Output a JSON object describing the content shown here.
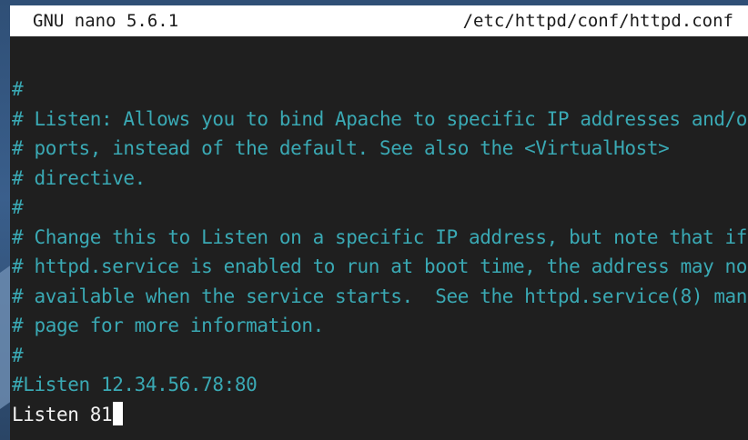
{
  "titlebar": {
    "app_version": "GNU nano 5.6.1",
    "file_path": "/etc/httpd/conf/httpd.conf"
  },
  "lines": [
    "#",
    "# Listen: Allows you to bind Apache to specific IP addresses and/or",
    "# ports, instead of the default. See also the <VirtualHost>",
    "# directive.",
    "#",
    "# Change this to Listen on a specific IP address, but note that if",
    "# httpd.service is enabled to run at boot time, the address may not be",
    "# available when the service starts.  See the httpd.service(8) man",
    "# page for more information.",
    "#",
    "#Listen 12.34.56.78:80",
    "Listen 81"
  ],
  "colors": {
    "comment": "#3aa9b4",
    "text": "#f1f1f1",
    "background": "#1f1f1f"
  }
}
